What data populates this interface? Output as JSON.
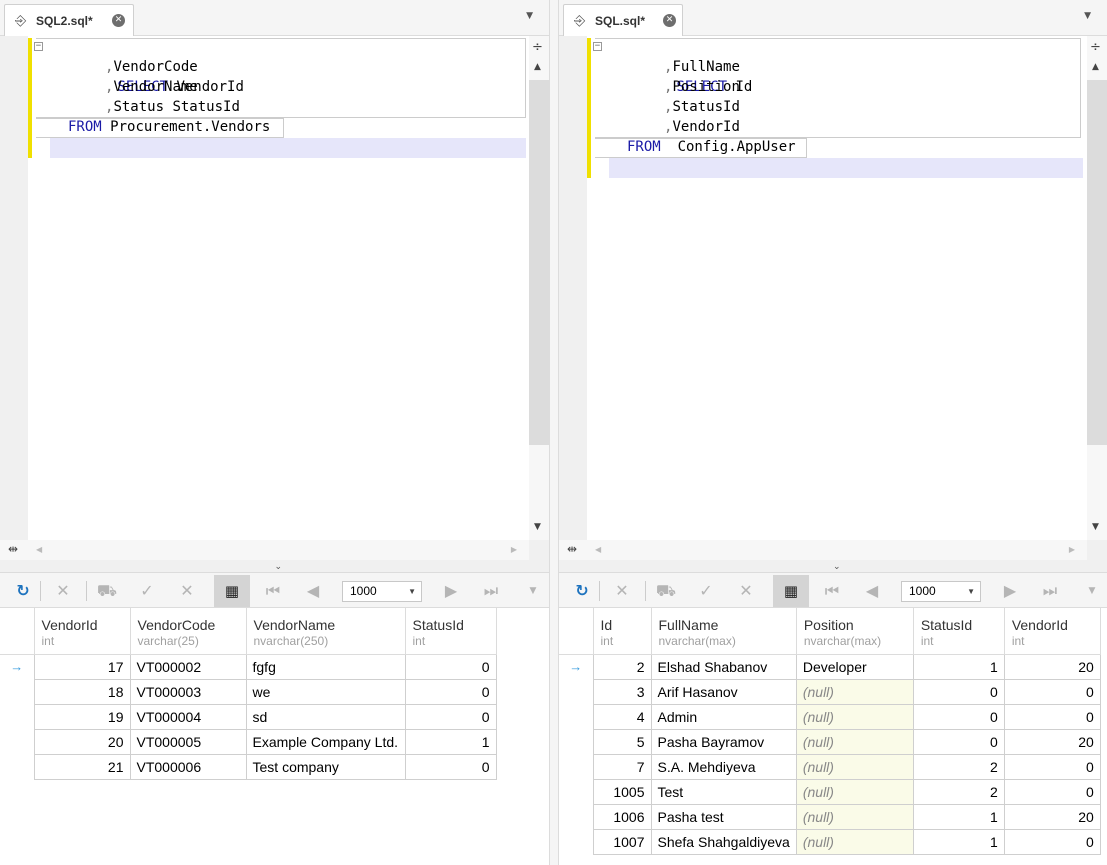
{
  "left": {
    "tab": {
      "title": "SQL2.sql*",
      "icon": "script-file-icon"
    },
    "code": {
      "select_kw": "SELECT",
      "from_kw": "FROM",
      "line1": "VendorId",
      "line2": "VendorCode",
      "line3": "VendorName",
      "line4": "Status StatusId",
      "from_target": "Procurement.Vendors"
    },
    "toolbar": {
      "limit": "1000"
    },
    "columns": [
      {
        "name": "VendorId",
        "type": "int"
      },
      {
        "name": "VendorCode",
        "type": "varchar(25)"
      },
      {
        "name": "VendorName",
        "type": "nvarchar(250)"
      },
      {
        "name": "StatusId",
        "type": "int"
      }
    ],
    "rows": [
      [
        "17",
        "VT000002",
        "fgfg",
        "0"
      ],
      [
        "18",
        "VT000003",
        "we",
        "0"
      ],
      [
        "19",
        "VT000004",
        "sd",
        "0"
      ],
      [
        "20",
        "VT000005",
        "Example Company Ltd.",
        "1"
      ],
      [
        "21",
        "VT000006",
        "Test company",
        "0"
      ]
    ]
  },
  "right": {
    "tab": {
      "title": "SQL.sql*",
      "icon": "script-file-icon"
    },
    "code": {
      "select_kw": "SELECT",
      "from_kw": "FROM",
      "line1": "Id",
      "line2": "FullName",
      "line3": "Position",
      "line4": "StatusId",
      "line5": "VendorId",
      "from_target": "Config.AppUser"
    },
    "toolbar": {
      "limit": "1000"
    },
    "columns": [
      {
        "name": "Id",
        "type": "int"
      },
      {
        "name": "FullName",
        "type": "nvarchar(max)"
      },
      {
        "name": "Position",
        "type": "nvarchar(max)"
      },
      {
        "name": "StatusId",
        "type": "int"
      },
      {
        "name": "VendorId",
        "type": "int"
      }
    ],
    "rows": [
      [
        "2",
        "Elshad Shabanov",
        "Developer",
        "1",
        "20"
      ],
      [
        "3",
        "Arif Hasanov",
        "(null)",
        "0",
        "0"
      ],
      [
        "4",
        "Admin",
        "(null)",
        "0",
        "0"
      ],
      [
        "5",
        "Pasha Bayramov",
        "(null)",
        "0",
        "20"
      ],
      [
        "7",
        "S.A. Mehdiyeva",
        "(null)",
        "2",
        "0"
      ],
      [
        "1005",
        "Test",
        "(null)",
        "2",
        "0"
      ],
      [
        "1006",
        "Pasha test",
        "(null)",
        "1",
        "20"
      ],
      [
        "1007",
        "Shefa Shahgaldiyeva",
        "(null)",
        "1",
        "0"
      ]
    ]
  },
  "row_indicator": "→",
  "colors": {
    "keyword": "#1a1aa6",
    "change_bar": "#f0e000",
    "current_line": "#e6e6fa",
    "null_cell": "#fafbe8",
    "refresh": "#1e73be"
  }
}
